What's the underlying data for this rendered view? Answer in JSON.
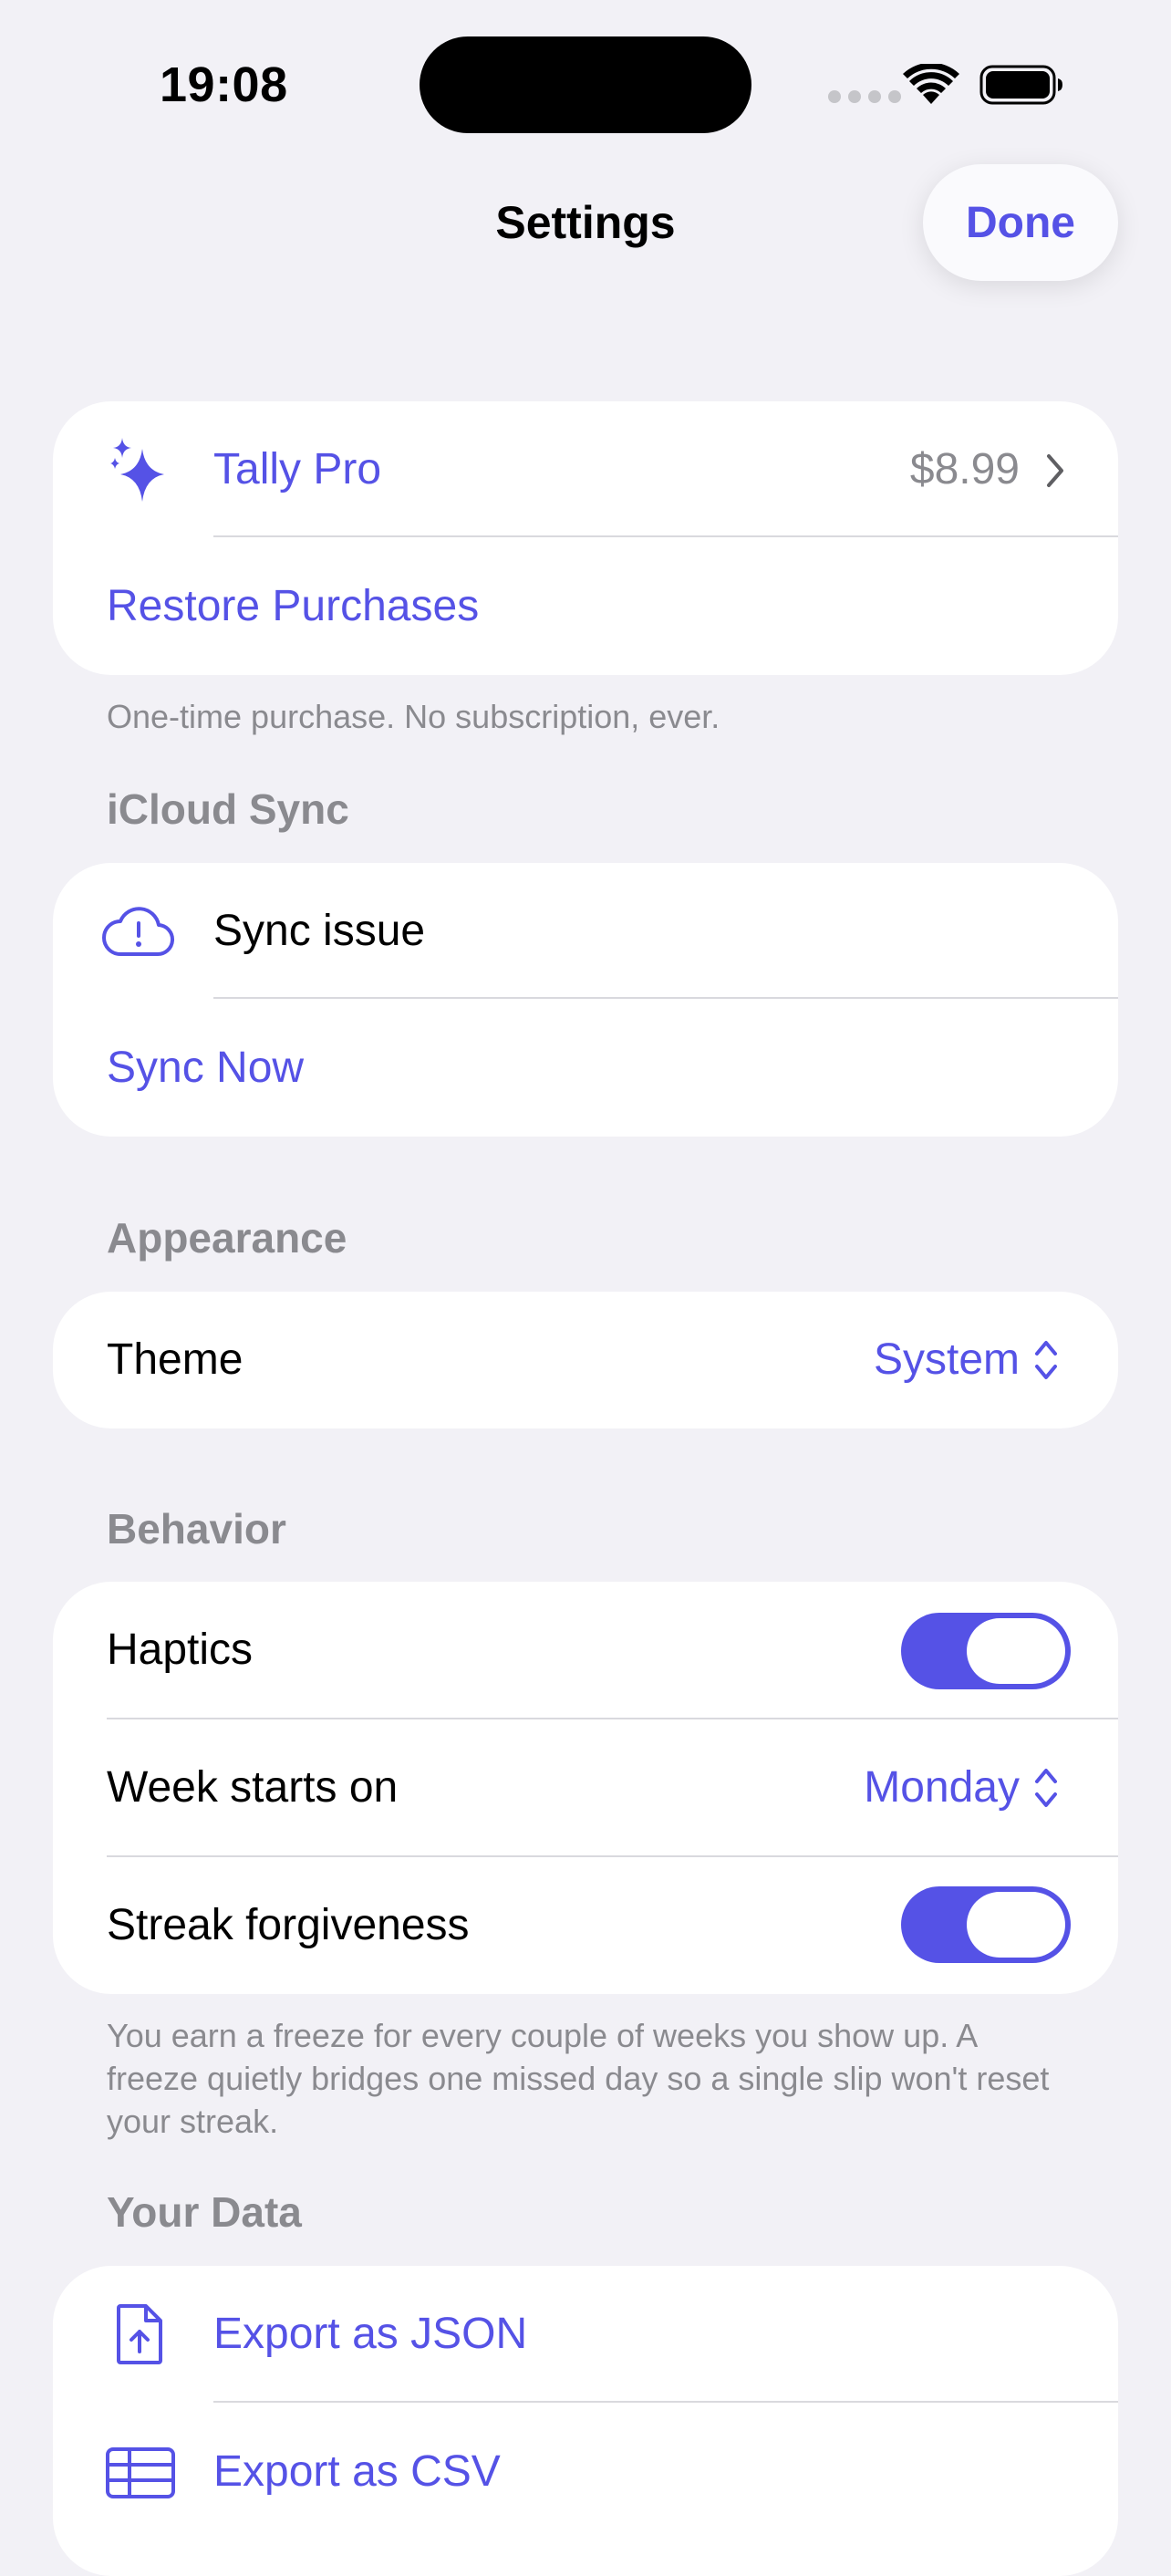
{
  "status_bar": {
    "time": "19:08"
  },
  "nav": {
    "title": "Settings",
    "done_label": "Done"
  },
  "pro": {
    "title": "Tally Pro",
    "price": "$8.99",
    "restore_label": "Restore Purchases",
    "footer": "One-time purchase. No subscription, ever.",
    "icon": "sparkles-icon"
  },
  "icloud": {
    "header": "iCloud Sync",
    "status": "Sync issue",
    "sync_now_label": "Sync Now",
    "icon": "cloud-alert-icon"
  },
  "appearance": {
    "header": "Appearance",
    "theme_label": "Theme",
    "theme_value": "System"
  },
  "behavior": {
    "header": "Behavior",
    "haptics_label": "Haptics",
    "haptics_on": true,
    "week_label": "Week starts on",
    "week_value": "Monday",
    "streak_label": "Streak forgiveness",
    "streak_on": true,
    "footer": "You earn a freeze for every couple of weeks you show up. A freeze quietly bridges one missed day so a single slip won't reset your streak."
  },
  "your_data": {
    "header": "Your Data",
    "export_json_label": "Export as JSON",
    "export_csv_label": "Export as CSV"
  },
  "colors": {
    "accent": "#5552e6",
    "background": "#f2f1f6",
    "secondary_text": "#8a8a8f"
  }
}
